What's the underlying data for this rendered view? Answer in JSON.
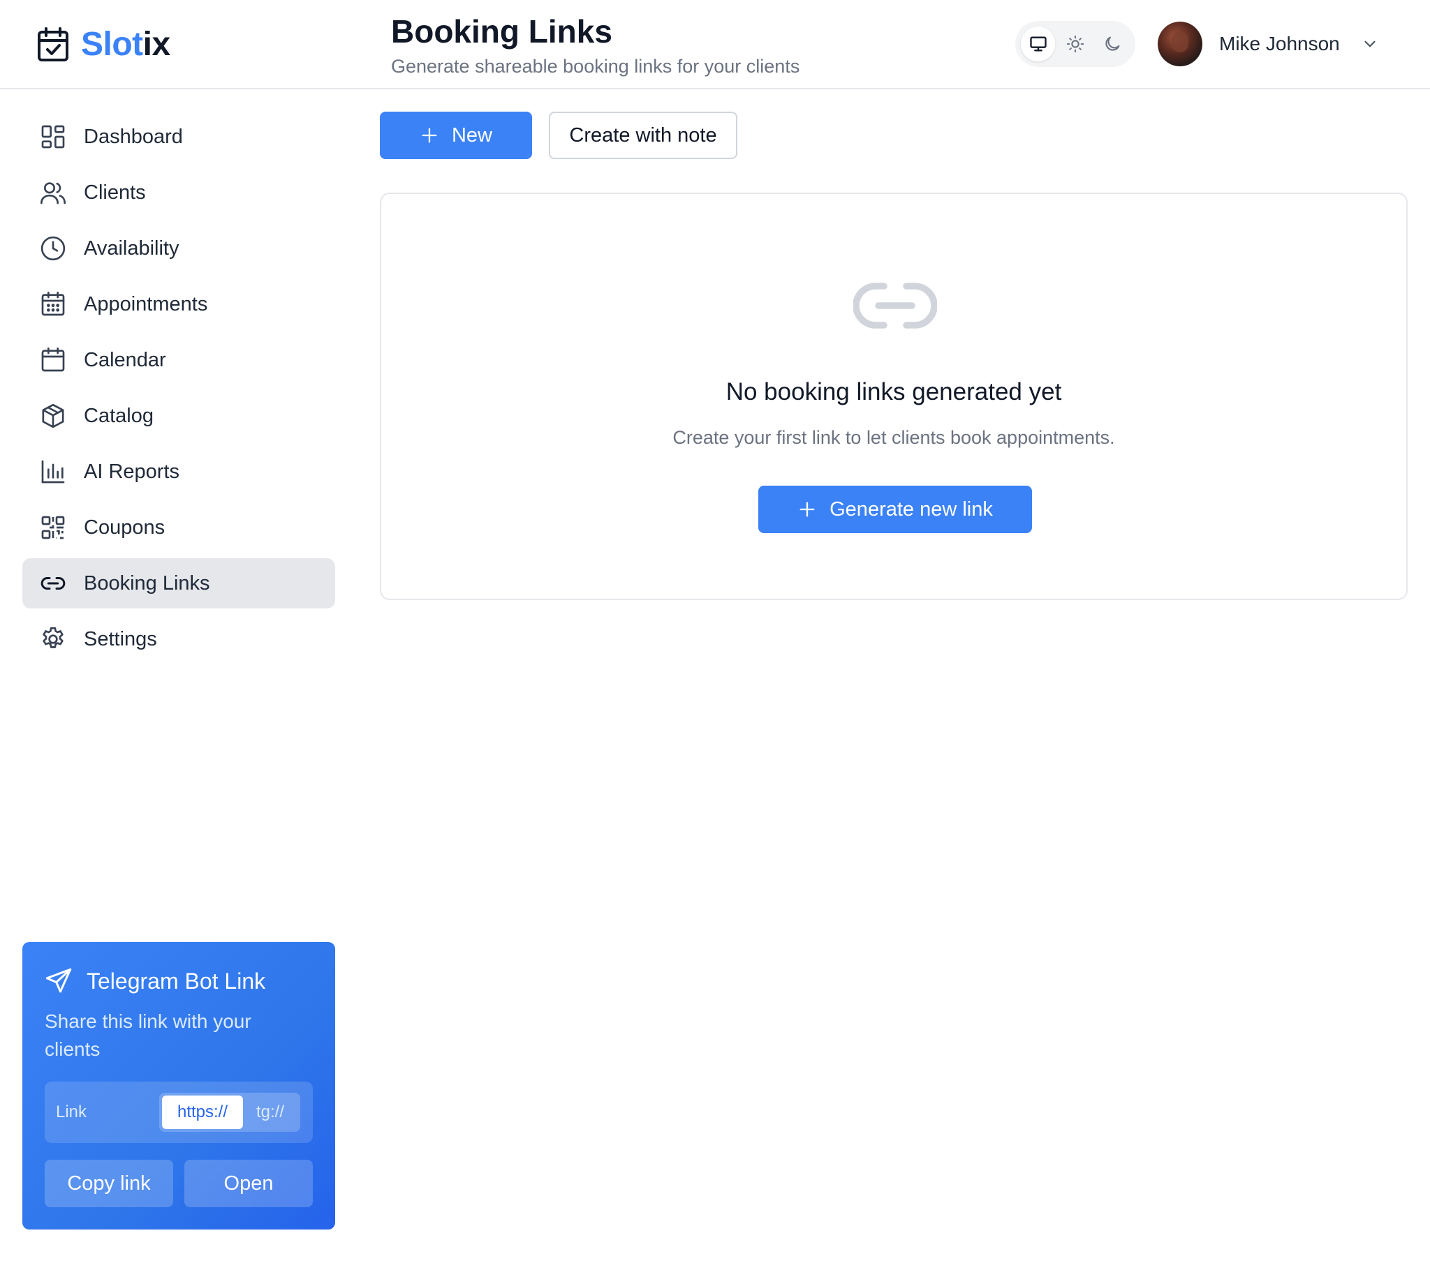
{
  "app": {
    "brand_part1": "Slot",
    "brand_part2": "ix",
    "brand_color": "#3b82f6"
  },
  "header": {
    "title": "Booking Links",
    "subtitle": "Generate shareable booking links for your clients",
    "theme_options": [
      {
        "icon": "monitor-icon",
        "active": true
      },
      {
        "icon": "sun-icon",
        "active": false
      },
      {
        "icon": "moon-icon",
        "active": false
      }
    ],
    "user": {
      "name": "Mike Johnson"
    }
  },
  "sidebar": {
    "items": [
      {
        "label": "Dashboard",
        "icon": "dashboard-grid-icon",
        "active": false
      },
      {
        "label": "Clients",
        "icon": "users-icon",
        "active": false
      },
      {
        "label": "Availability",
        "icon": "clock-icon",
        "active": false
      },
      {
        "label": "Appointments",
        "icon": "calendar-grid-icon",
        "active": false
      },
      {
        "label": "Calendar",
        "icon": "calendar-icon",
        "active": false
      },
      {
        "label": "Catalog",
        "icon": "box-icon",
        "active": false
      },
      {
        "label": "AI Reports",
        "icon": "bar-chart-icon",
        "active": false
      },
      {
        "label": "Coupons",
        "icon": "qr-code-icon",
        "active": false
      },
      {
        "label": "Booking Links",
        "icon": "link-icon",
        "active": true
      },
      {
        "label": "Settings",
        "icon": "gear-icon",
        "active": false
      }
    ]
  },
  "telegram_card": {
    "title": "Telegram Bot Link",
    "description": "Share this link with your clients",
    "link_label": "Link",
    "protocol_options": [
      "https://",
      "tg://"
    ],
    "selected_protocol": "https://",
    "copy_label": "Copy link",
    "open_label": "Open"
  },
  "toolbar": {
    "new_label": "New",
    "note_label": "Create with note"
  },
  "empty_state": {
    "title": "No booking links generated yet",
    "description": "Create your first link to let clients book appointments.",
    "button_label": "Generate new link"
  },
  "colors": {
    "primary": "#3b82f6",
    "active_nav_bg": "#e5e7eb",
    "text_muted": "#6b7280"
  }
}
